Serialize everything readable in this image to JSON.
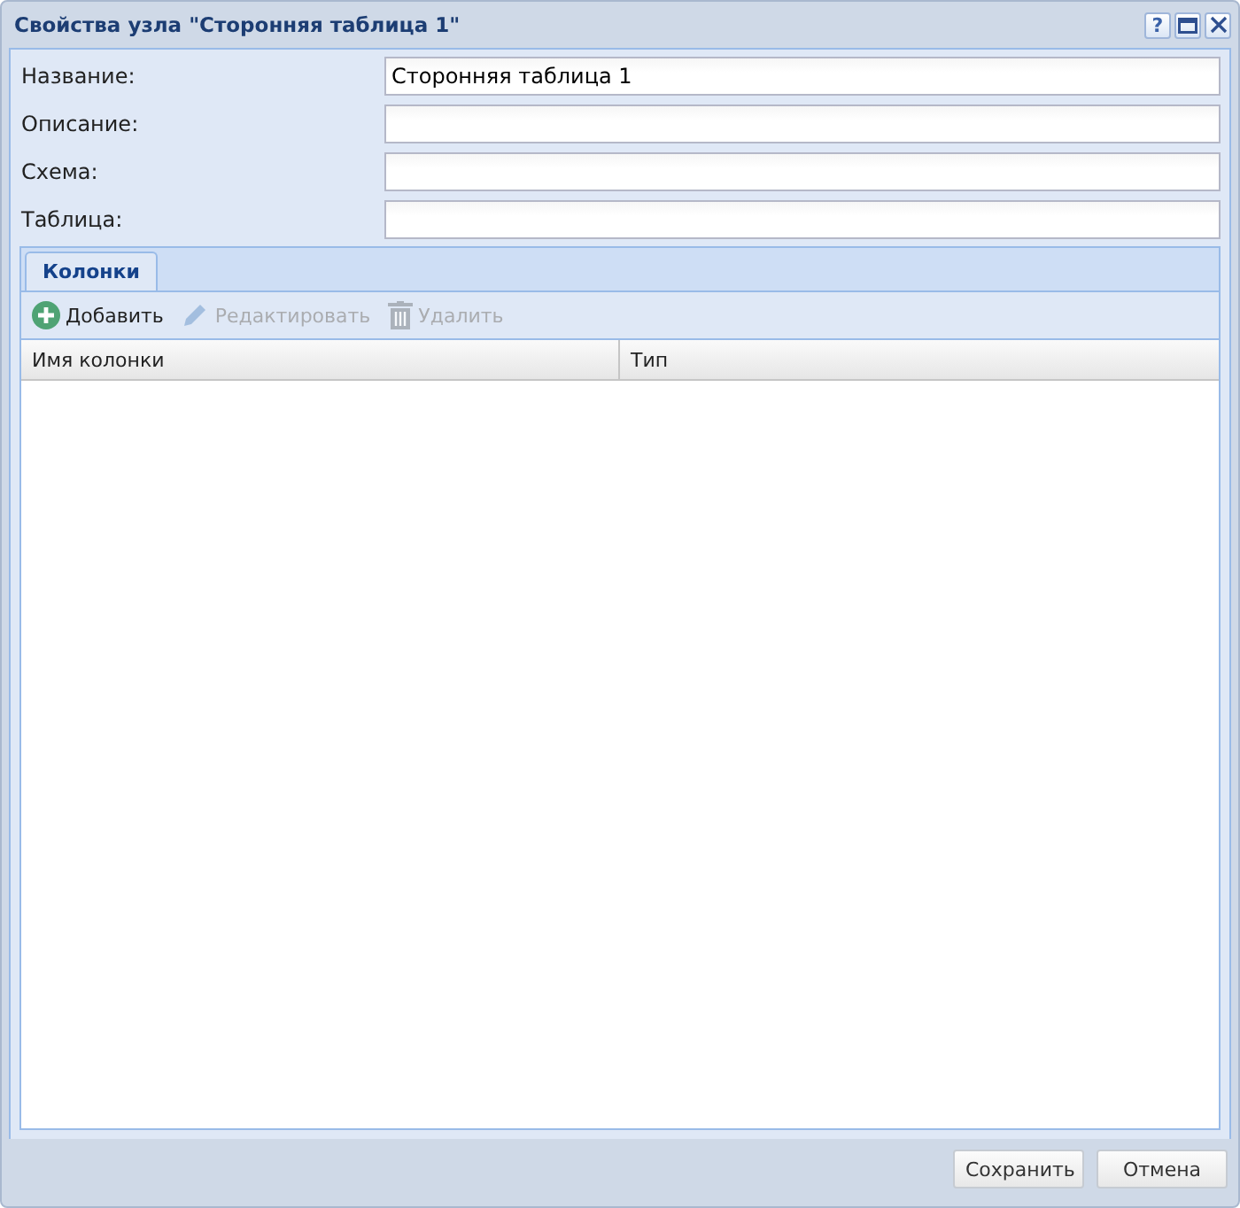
{
  "window": {
    "title": "Свойства узла \"Сторонняя таблица 1\"",
    "help_glyph": "?"
  },
  "fields": [
    {
      "label": "Название:",
      "value": "Сторонняя таблица 1"
    },
    {
      "label": "Описание:"
    },
    {
      "label": "Схема:"
    },
    {
      "label": "Таблица:"
    }
  ],
  "tabs": [
    {
      "label": "Колонки",
      "selected": true
    }
  ],
  "toolbar": [
    {
      "kind": "add",
      "label": "Добавить",
      "disabled": false
    },
    {
      "kind": "edit",
      "label": "Редактировать",
      "disabled": true
    },
    {
      "kind": "delete",
      "label": "Удалить",
      "disabled": true
    }
  ],
  "table": {
    "columns": [
      "Имя колонки",
      "Тип"
    ]
  },
  "buttons": [
    "Сохранить",
    "Отмена"
  ]
}
